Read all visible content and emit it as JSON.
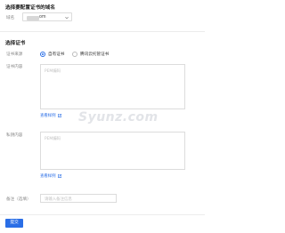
{
  "domain_section": {
    "title": "选择要配置证书的域名",
    "domain_label": "域名",
    "domain_value": "om"
  },
  "cert_section": {
    "title": "选择证书",
    "source_label": "证书来源",
    "source_options": [
      {
        "label": "自有证书",
        "selected": true
      },
      {
        "label": "腾讯云托管证书",
        "selected": false
      }
    ],
    "cert_content_label": "证书内容",
    "cert_content_placeholder": "PEM编码",
    "view_sample_1": "查看样例",
    "private_key_label": "私钥内容",
    "private_key_placeholder": "PEM编码",
    "view_sample_2": "查看样例",
    "remark_label": "备注（选填）",
    "remark_placeholder": "请输入备注信息"
  },
  "watermark": {
    "text": "Syunz.com"
  },
  "footer": {
    "submit_label": "提交"
  },
  "colors": {
    "accent": "#2a6ee6",
    "border": "#dcdcdc",
    "muted_text": "#888888"
  }
}
